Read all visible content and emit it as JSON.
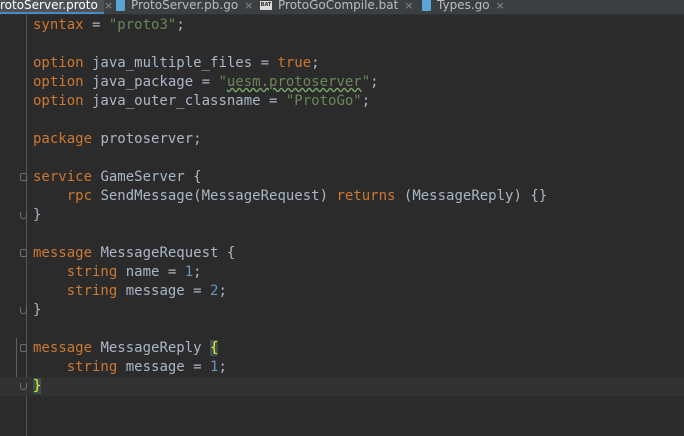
{
  "tabs": [
    {
      "label": "rotoServer.proto",
      "icon": "proto-file-icon",
      "active": true
    },
    {
      "label": "ProtoServer.pb.go",
      "icon": "go-file-icon",
      "active": false
    },
    {
      "label": "ProtoGoCompile.bat",
      "icon": "bat-file-icon",
      "active": false
    },
    {
      "label": "Types.go",
      "icon": "go-file-icon",
      "active": false
    }
  ],
  "tab_close_glyph": "×",
  "bat_icon_text": "BAT",
  "code_lines": [
    "syntax = \"proto3\";",
    "",
    "option java_multiple_files = true;",
    "option java_package = \"uesm.protoserver\";",
    "option java_outer_classname = \"ProtoGo\";",
    "",
    "package protoserver;",
    "",
    "service GameServer {",
    "    rpc SendMessage(MessageRequest) returns (MessageReply) {}",
    "}",
    "",
    "message MessageRequest {",
    "    string name = 1;",
    "    string message = 2;",
    "}",
    "",
    "message MessageReply {",
    "    string message = 1;",
    "}"
  ],
  "colors": {
    "background": "#2b2b2b",
    "keyword": "#cc7832",
    "string": "#6a8759",
    "number": "#6897bb",
    "text": "#a9b7c6",
    "brace_match": "#ffef28"
  }
}
